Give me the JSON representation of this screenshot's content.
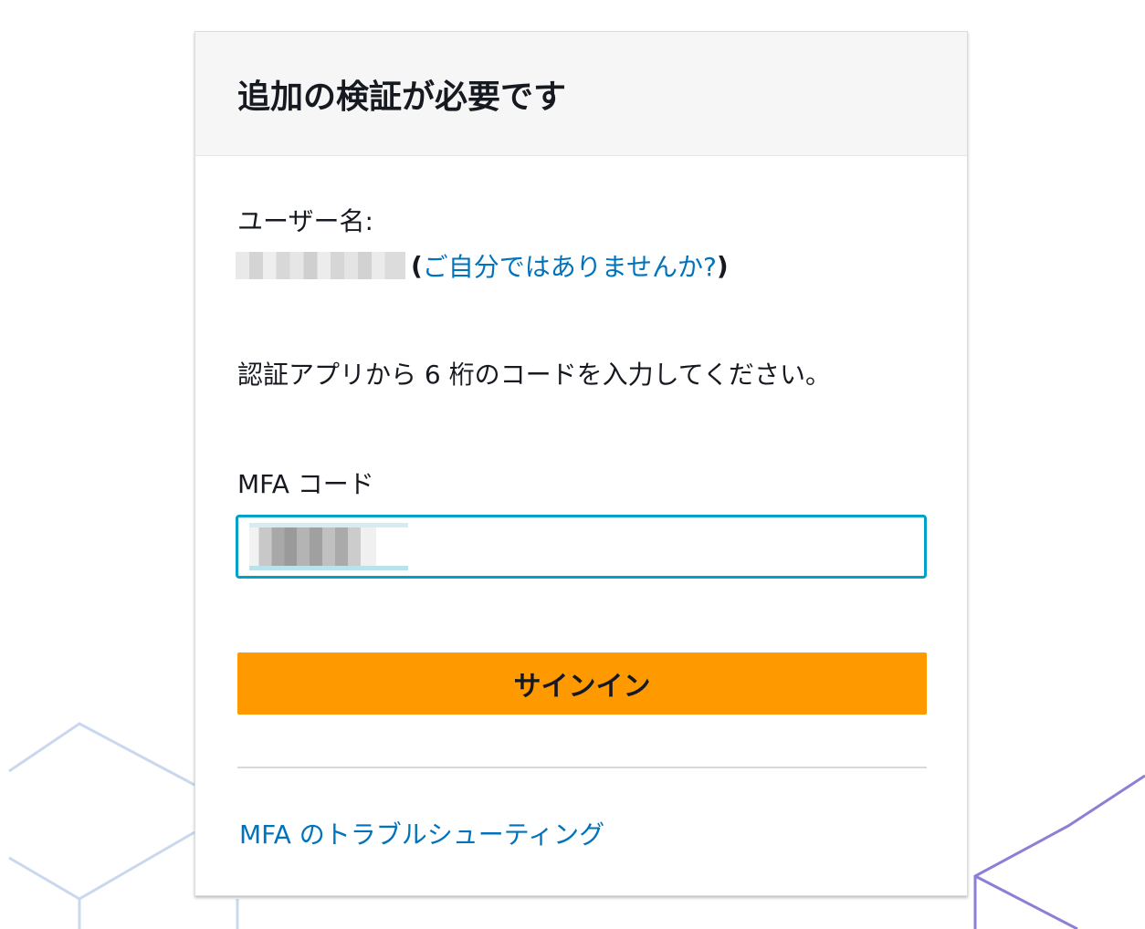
{
  "dialog": {
    "title": "追加の検証が必要です",
    "username_label": "ユーザー名:",
    "paren_open": "(",
    "not_you_link": "ご自分ではありませんか?",
    "paren_close": ")",
    "instruction": "認証アプリから 6 桁のコードを入力してください。",
    "mfa_label": "MFA コード",
    "mfa_input_value": "",
    "signin_button": "サインイン",
    "troubleshoot_link": "MFA のトラブルシューティング"
  },
  "colors": {
    "link": "#0073bb",
    "primary_button": "#ff9900",
    "input_focus": "#00a1c9",
    "header_bg": "#f6f6f6"
  }
}
